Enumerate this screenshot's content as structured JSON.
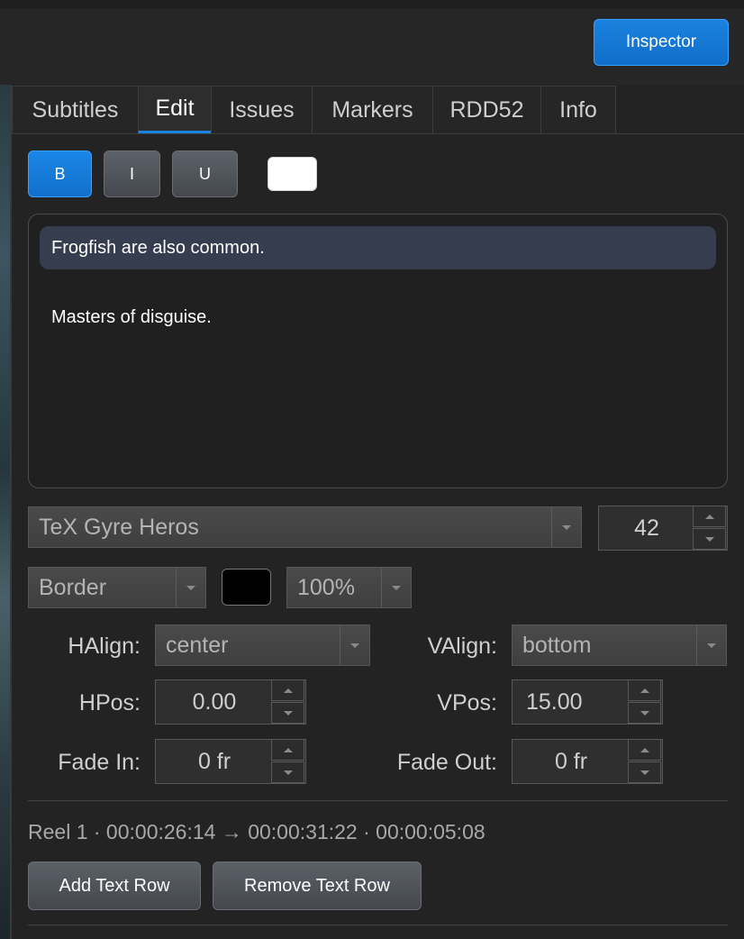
{
  "header": {
    "inspector_label": "Inspector"
  },
  "tabs": [
    {
      "label": "Subtitles",
      "active": false
    },
    {
      "label": "Edit",
      "active": true
    },
    {
      "label": "Issues",
      "active": false
    },
    {
      "label": "Markers",
      "active": false
    },
    {
      "label": "RDD52",
      "active": false
    },
    {
      "label": "Info",
      "active": false
    }
  ],
  "format": {
    "bold": "B",
    "italic": "I",
    "underline": "U",
    "text_color": "#ffffff"
  },
  "text_rows": [
    {
      "text": "Frogfish are also common.",
      "selected": true
    },
    {
      "text": "Masters of disguise.",
      "selected": false
    }
  ],
  "font": {
    "family": "TeX Gyre Heros",
    "size": "42"
  },
  "effect": {
    "type": "Border",
    "color": "#000000",
    "opacity": "100%"
  },
  "position": {
    "halign_label": "HAlign:",
    "halign": "center",
    "valign_label": "VAlign:",
    "valign": "bottom",
    "hpos_label": "HPos:",
    "hpos": "0.00",
    "vpos_label": "VPos:",
    "vpos": "15.00",
    "fade_in_label": "Fade In:",
    "fade_in": "0 fr",
    "fade_out_label": "Fade Out:",
    "fade_out": "0 fr"
  },
  "timing": {
    "text": "Reel 1 · 00:00:26:14 → 00:00:31:22 · 00:00:05:08"
  },
  "actions": {
    "add_label": "Add Text Row",
    "remove_label": "Remove Text Row"
  },
  "colors": {
    "accent": "#1a82e0",
    "background": "#232323"
  }
}
